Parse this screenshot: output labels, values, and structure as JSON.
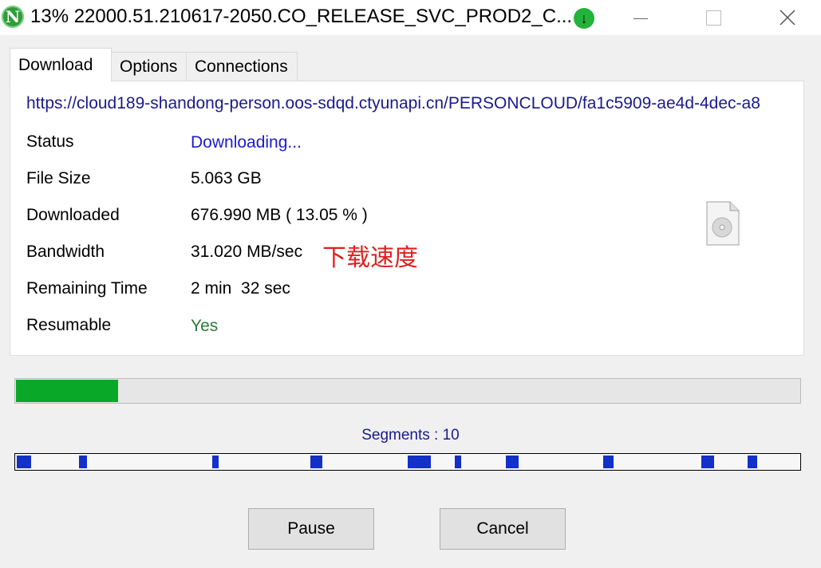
{
  "window": {
    "title": "13%  22000.51.210617-2050.CO_RELEASE_SVC_PROD2_C...",
    "app_icon_letter": "N",
    "download_indicator": "↓"
  },
  "tabs": [
    {
      "label": "Download",
      "active": true
    },
    {
      "label": "Options",
      "active": false
    },
    {
      "label": "Connections",
      "active": false
    }
  ],
  "download": {
    "url": "https://cloud189-shandong-person.oos-sdqd.ctyunapi.cn/PERSONCLOUD/fa1c5909-ae4d-4dec-a8",
    "rows": [
      {
        "label": "Status",
        "value": "Downloading..."
      },
      {
        "label": "File Size",
        "value": "5.063 GB"
      },
      {
        "label": "Downloaded",
        "value": "676.990 MB ( 13.05 % )"
      },
      {
        "label": "Bandwidth",
        "value": "31.020 MB/sec"
      },
      {
        "label": "Remaining Time",
        "value": "2 min  32 sec"
      },
      {
        "label": "Resumable",
        "value": "Yes"
      }
    ],
    "annotation": "下载速度",
    "file_icon": "disc-file-icon"
  },
  "progress": {
    "percent": 13.05,
    "color": "#0aa829"
  },
  "segments": {
    "label": "Segments : 10",
    "positions": [
      0.0,
      0.08,
      0.25,
      0.375,
      0.5,
      0.56,
      0.625,
      0.75,
      0.875,
      0.935
    ],
    "widths": [
      0.018,
      0.01,
      0.008,
      0.015,
      0.03,
      0.008,
      0.016,
      0.013,
      0.016,
      0.012
    ],
    "color": "#1330c8"
  },
  "buttons": {
    "pause": "Pause",
    "cancel": "Cancel"
  }
}
